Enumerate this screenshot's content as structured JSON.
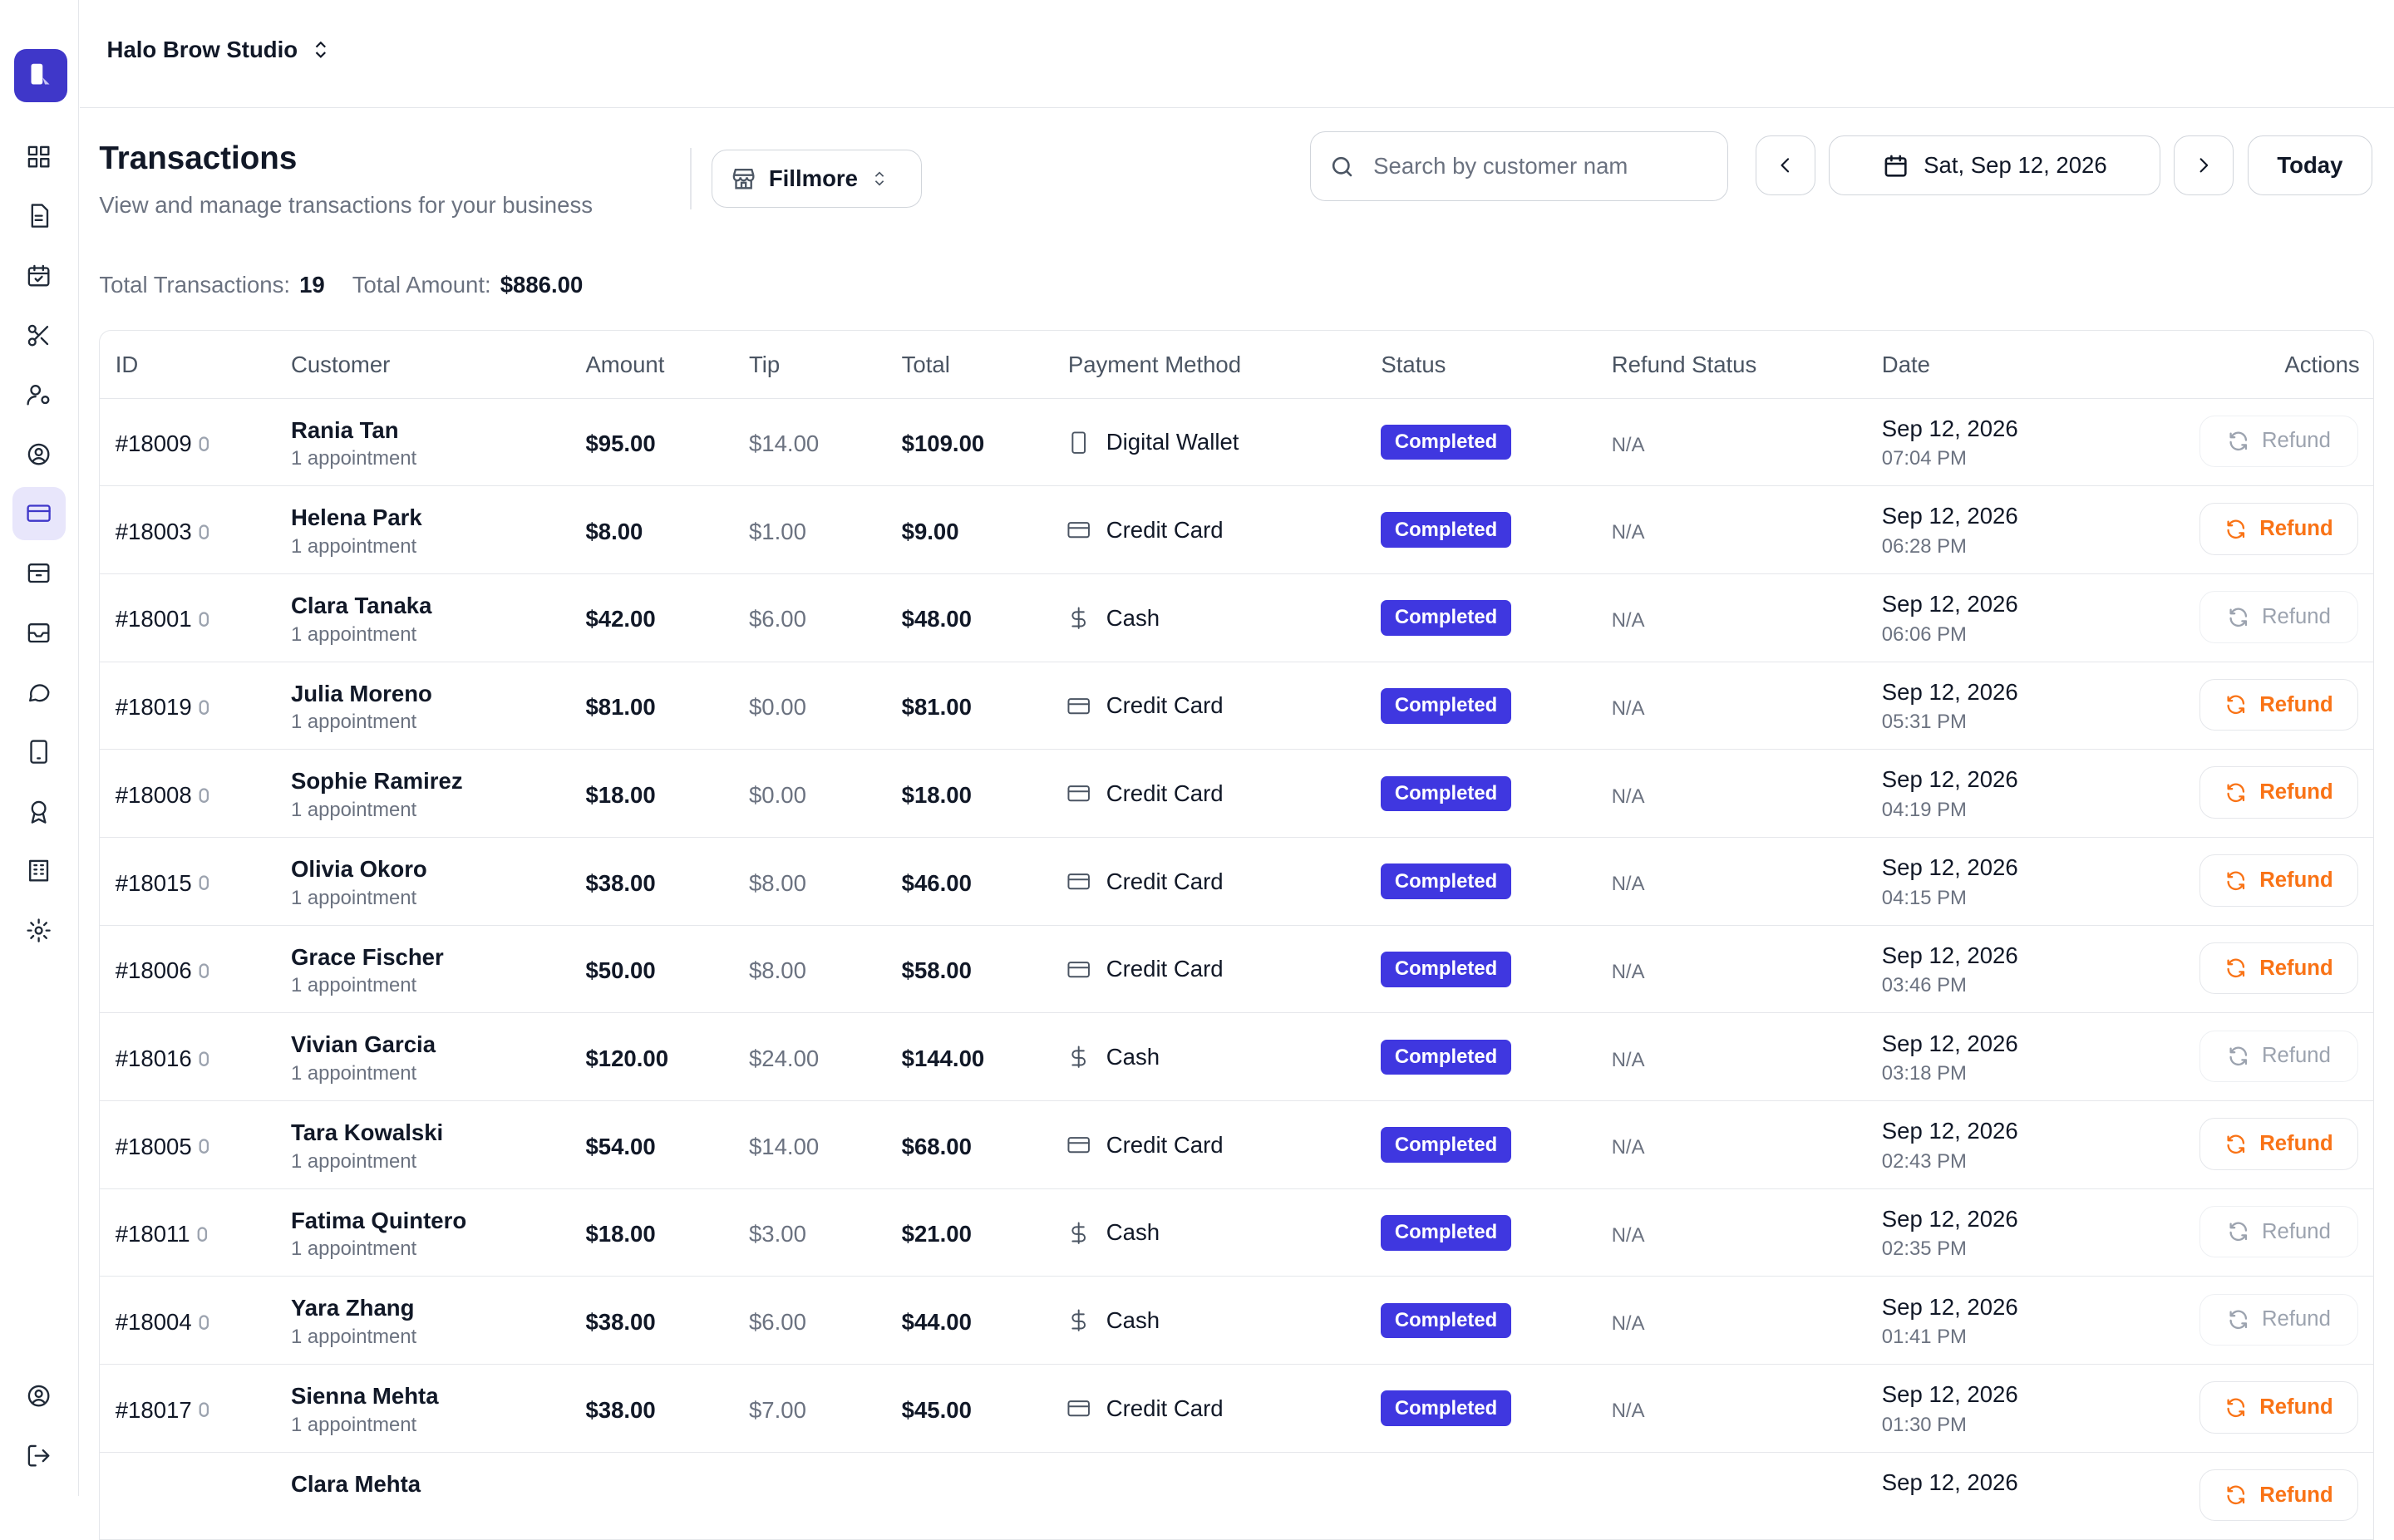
{
  "business": {
    "name": "Halo Brow Studio"
  },
  "sidebar": {
    "items": [
      {
        "icon": "dashboard-icon"
      },
      {
        "icon": "document-icon"
      },
      {
        "icon": "calendar-check-icon"
      },
      {
        "icon": "scissors-icon"
      },
      {
        "icon": "staff-icon"
      },
      {
        "icon": "user-circle-icon"
      },
      {
        "icon": "credit-card-icon",
        "active": true
      },
      {
        "icon": "archive-icon"
      },
      {
        "icon": "inbox-icon"
      },
      {
        "icon": "message-icon"
      },
      {
        "icon": "tablet-icon"
      },
      {
        "icon": "award-icon"
      },
      {
        "icon": "building-icon"
      },
      {
        "icon": "gear-icon"
      }
    ],
    "bottom": [
      {
        "icon": "account-icon"
      },
      {
        "icon": "logout-icon"
      }
    ]
  },
  "page": {
    "title": "Transactions",
    "subtitle": "View and manage transactions for your business",
    "location": "Fillmore",
    "search_placeholder": "Search by customer nam",
    "date": "Sat, Sep 12, 2026",
    "today_label": "Today"
  },
  "stats": {
    "total_transactions_label": "Total Transactions:",
    "total_transactions": "19",
    "total_amount_label": "Total Amount:",
    "total_amount": "$886.00"
  },
  "columns": [
    "ID",
    "Customer",
    "Amount",
    "Tip",
    "Total",
    "Payment Method",
    "Status",
    "Refund Status",
    "Date",
    "Actions"
  ],
  "refund_label": "Refund",
  "accent_color": "#3f37e0",
  "refund_color": "#f97316",
  "rows": [
    {
      "id": "#18009",
      "name": "Rania Tan",
      "appt": "1 appointment",
      "amount": "$95.00",
      "tip": "$14.00",
      "total": "$109.00",
      "payment": "Digital Wallet",
      "pay_icon": "wallet",
      "status": "Completed",
      "refund_status": "N/A",
      "date": "Sep 12, 2026",
      "time": "07:04 PM",
      "refund_enabled": false
    },
    {
      "id": "#18003",
      "name": "Helena Park",
      "appt": "1 appointment",
      "amount": "$8.00",
      "tip": "$1.00",
      "total": "$9.00",
      "payment": "Credit Card",
      "pay_icon": "card",
      "status": "Completed",
      "refund_status": "N/A",
      "date": "Sep 12, 2026",
      "time": "06:28 PM",
      "refund_enabled": true
    },
    {
      "id": "#18001",
      "name": "Clara Tanaka",
      "appt": "1 appointment",
      "amount": "$42.00",
      "tip": "$6.00",
      "total": "$48.00",
      "payment": "Cash",
      "pay_icon": "cash",
      "status": "Completed",
      "refund_status": "N/A",
      "date": "Sep 12, 2026",
      "time": "06:06 PM",
      "refund_enabled": false
    },
    {
      "id": "#18019",
      "name": "Julia Moreno",
      "appt": "1 appointment",
      "amount": "$81.00",
      "tip": "$0.00",
      "total": "$81.00",
      "payment": "Credit Card",
      "pay_icon": "card",
      "status": "Completed",
      "refund_status": "N/A",
      "date": "Sep 12, 2026",
      "time": "05:31 PM",
      "refund_enabled": true
    },
    {
      "id": "#18008",
      "name": "Sophie Ramirez",
      "appt": "1 appointment",
      "amount": "$18.00",
      "tip": "$0.00",
      "total": "$18.00",
      "payment": "Credit Card",
      "pay_icon": "card",
      "status": "Completed",
      "refund_status": "N/A",
      "date": "Sep 12, 2026",
      "time": "04:19 PM",
      "refund_enabled": true
    },
    {
      "id": "#18015",
      "name": "Olivia Okoro",
      "appt": "1 appointment",
      "amount": "$38.00",
      "tip": "$8.00",
      "total": "$46.00",
      "payment": "Credit Card",
      "pay_icon": "card",
      "status": "Completed",
      "refund_status": "N/A",
      "date": "Sep 12, 2026",
      "time": "04:15 PM",
      "refund_enabled": true
    },
    {
      "id": "#18006",
      "name": "Grace Fischer",
      "appt": "1 appointment",
      "amount": "$50.00",
      "tip": "$8.00",
      "total": "$58.00",
      "payment": "Credit Card",
      "pay_icon": "card",
      "status": "Completed",
      "refund_status": "N/A",
      "date": "Sep 12, 2026",
      "time": "03:46 PM",
      "refund_enabled": true
    },
    {
      "id": "#18016",
      "name": "Vivian Garcia",
      "appt": "1 appointment",
      "amount": "$120.00",
      "tip": "$24.00",
      "total": "$144.00",
      "payment": "Cash",
      "pay_icon": "cash",
      "status": "Completed",
      "refund_status": "N/A",
      "date": "Sep 12, 2026",
      "time": "03:18 PM",
      "refund_enabled": false
    },
    {
      "id": "#18005",
      "name": "Tara Kowalski",
      "appt": "1 appointment",
      "amount": "$54.00",
      "tip": "$14.00",
      "total": "$68.00",
      "payment": "Credit Card",
      "pay_icon": "card",
      "status": "Completed",
      "refund_status": "N/A",
      "date": "Sep 12, 2026",
      "time": "02:43 PM",
      "refund_enabled": true
    },
    {
      "id": "#18011",
      "name": "Fatima Quintero",
      "appt": "1 appointment",
      "amount": "$18.00",
      "tip": "$3.00",
      "total": "$21.00",
      "payment": "Cash",
      "pay_icon": "cash",
      "status": "Completed",
      "refund_status": "N/A",
      "date": "Sep 12, 2026",
      "time": "02:35 PM",
      "refund_enabled": false
    },
    {
      "id": "#18004",
      "name": "Yara Zhang",
      "appt": "1 appointment",
      "amount": "$38.00",
      "tip": "$6.00",
      "total": "$44.00",
      "payment": "Cash",
      "pay_icon": "cash",
      "status": "Completed",
      "refund_status": "N/A",
      "date": "Sep 12, 2026",
      "time": "01:41 PM",
      "refund_enabled": false
    },
    {
      "id": "#18017",
      "name": "Sienna Mehta",
      "appt": "1 appointment",
      "amount": "$38.00",
      "tip": "$7.00",
      "total": "$45.00",
      "payment": "Credit Card",
      "pay_icon": "card",
      "status": "Completed",
      "refund_status": "N/A",
      "date": "Sep 12, 2026",
      "time": "01:30 PM",
      "refund_enabled": true
    },
    {
      "id": "",
      "name": "Clara Mehta",
      "appt": "",
      "amount": "",
      "tip": "",
      "total": "",
      "payment": "",
      "pay_icon": "card",
      "status": "",
      "refund_status": "",
      "date": "Sep 12, 2026",
      "time": "",
      "refund_enabled": true
    }
  ]
}
